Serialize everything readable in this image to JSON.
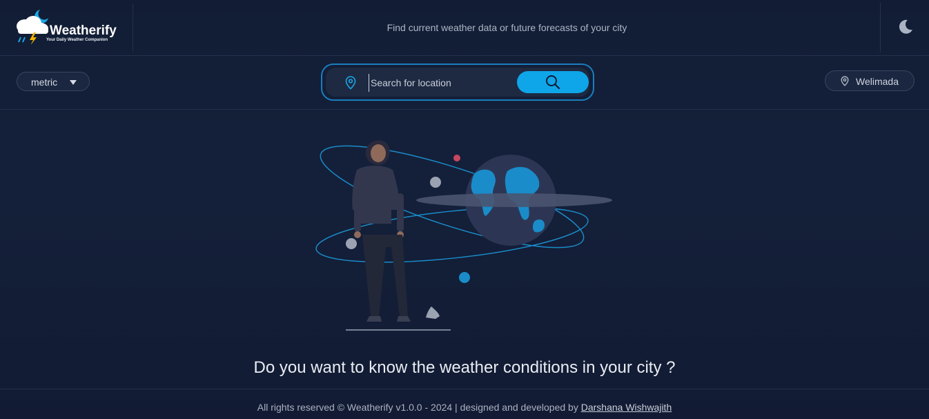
{
  "app": {
    "brand_name": "Weatherify",
    "brand_tagline": "Your Daily Weather Companion",
    "header_tagline": "Find current weather data or future forecasts of your city"
  },
  "toolbar": {
    "unit_selected": "metric",
    "search_placeholder": "Search for location",
    "search_value": "",
    "current_location": "Welimada"
  },
  "main": {
    "prompt": "Do you want to know the weather conditions in your city ?"
  },
  "footer": {
    "text": "All rights reserved © Weatherify v1.0.0 - 2024 | designed and developed by",
    "author_link": "Darshana Wishwajith"
  },
  "colors": {
    "accent": "#0ea5e9",
    "search_border": "#1b7fc0",
    "background": "#131e36"
  },
  "icons": {
    "logo": "cloud-moon-lightning-icon",
    "theme": "moon-icon",
    "unit_caret": "chevron-down-icon",
    "search_pin": "location-pin-icon",
    "search": "search-icon",
    "location": "location-pin-icon"
  }
}
